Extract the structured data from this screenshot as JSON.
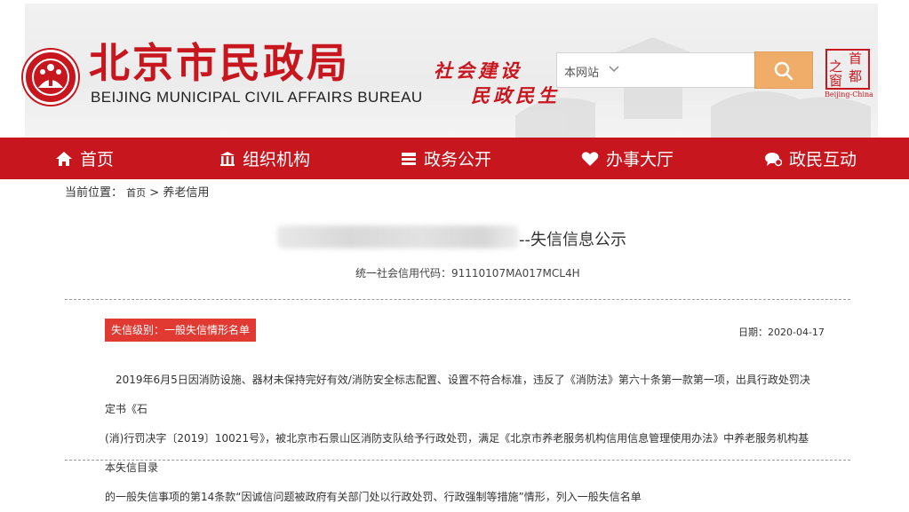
{
  "header": {
    "title_cn": "北京市民政局",
    "title_en": "BEIJING MUNICIPAL CIVIL AFFAIRS BUREAU",
    "slogan_line1": "社会建设",
    "slogan_line2": "民政民生",
    "search": {
      "scope_label": "本网站",
      "scope_icon": "chevron-down-icon",
      "button_icon": "search-icon",
      "input_value": ""
    },
    "capital_badge": {
      "char_zhi": "之",
      "char_shou": "首",
      "char_du": "都",
      "char_chuang": "窗",
      "caption": "Beijing-China"
    },
    "brand_color": "#c8161e"
  },
  "nav": {
    "items": [
      {
        "label": "首页",
        "icon": "home-icon"
      },
      {
        "label": "组织机构",
        "icon": "building-icon"
      },
      {
        "label": "政务公开",
        "icon": "document-icon"
      },
      {
        "label": "办事大厅",
        "icon": "heart-icon"
      },
      {
        "label": "政民互动",
        "icon": "chat-icon"
      }
    ]
  },
  "breadcrumb": {
    "prefix": "当前位置：",
    "home": "首页",
    "separator": ">",
    "current": "养老信用"
  },
  "article": {
    "title_suffix": "--失信信息公示",
    "credit_code": "统一社会信用代码：91110107MA017MCL4H",
    "credit_level": "失信级别：一般失信情形名单",
    "date": "日期：2020-04-17",
    "body_line1": "2019年6月5日因消防设施、器材未保持完好有效/消防安全标志配置、设置不符合标准，违反了《消防法》第六十条第一款第一项，出具行政处罚决定书《石",
    "body_line2": "(消)行罚决字〔2019〕10021号》，被北京市石景山区消防支队给予行政处罚，满足《北京市养老服务机构信用信息管理使用办法》中养老服务机构基本失信目录",
    "body_line3": "的一般失信事项的第14条款“因诚信问题被政府有关部门处以行政处罚、行政强制等措施”情形，列入一般失信名单"
  },
  "colors": {
    "nav_background": "#c8161e",
    "search_button": "#f0ad6a",
    "credit_badge": "#e03a32"
  }
}
